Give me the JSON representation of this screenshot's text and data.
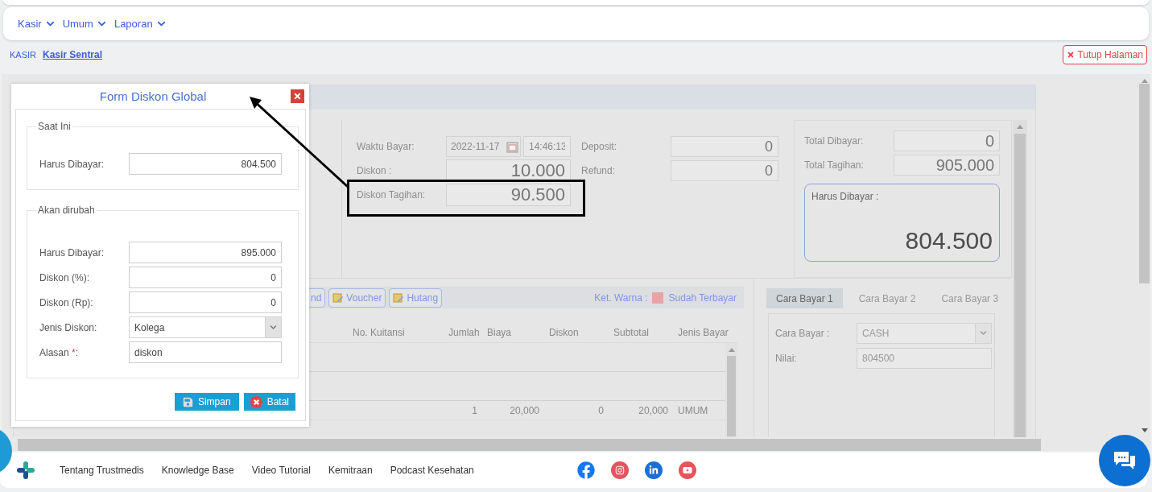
{
  "nav": [
    {
      "label": "Kasir"
    },
    {
      "label": "Umum"
    },
    {
      "label": "Laporan"
    }
  ],
  "breadcrumb": {
    "section": "KASIR",
    "page": "Kasir Sentral"
  },
  "close_page_button": {
    "label": "Tutup Halaman"
  },
  "payment_info": {
    "waktu_bayar": {
      "label": "Waktu Bayar:",
      "date": "2022-11-17",
      "time": "14:46:13"
    },
    "diskon": {
      "label": "Diskon :",
      "value": "10.000"
    },
    "diskon_tagihan": {
      "label": "Diskon Tagihan:",
      "value": "90.500"
    },
    "deposit": {
      "label": "Deposit:",
      "value": "0"
    },
    "refund": {
      "label": "Refund:",
      "value": "0"
    }
  },
  "totals": {
    "total_dibayar": {
      "label": "Total Dibayar:",
      "value": "0"
    },
    "total_tagihan": {
      "label": "Total Tagihan:",
      "value": "905.000"
    },
    "harus_dibayar": {
      "label": "Harus Dibayar :",
      "value": "804.500"
    }
  },
  "toolbar": {
    "buttons": [
      {
        "label": "nd",
        "icon": false
      },
      {
        "label": "Voucher",
        "icon": true
      },
      {
        "label": "Hutang",
        "icon": true
      }
    ],
    "legend": {
      "label": "Ket. Warna :",
      "items": [
        {
          "label": "Sudah Terbayar",
          "color": "#e8a3a6"
        }
      ]
    }
  },
  "table": {
    "columns": [
      "No. Kuitansi",
      "Jumlah",
      "Biaya",
      "Diskon",
      "Subtotal",
      "Jenis Bayar"
    ],
    "rows": [
      {
        "kind": "blank"
      },
      {
        "kind": "blank"
      },
      {
        "kind": "item",
        "jumlah": "1",
        "biaya": "20,000",
        "diskon": "0",
        "subtotal": "20,000",
        "jenis_bayar": "UMUM"
      }
    ]
  },
  "payment_tabs": [
    {
      "label": "Cara Bayar 1",
      "selected": true
    },
    {
      "label": "Cara Bayar 2",
      "selected": false
    },
    {
      "label": "Cara Bayar 3",
      "selected": false
    }
  ],
  "payment_method": {
    "cara_bayar": {
      "label": "Cara Bayar :",
      "value": "CASH"
    },
    "nilai": {
      "label": "Nilai:",
      "value": "804500"
    }
  },
  "modal": {
    "title": "Form Diskon Global",
    "sections": [
      {
        "legend": "Saat Ini",
        "fields": [
          {
            "kind": "number",
            "label": "Harus Dibayar:",
            "value": "804.500"
          }
        ]
      },
      {
        "legend": "Akan dirubah",
        "fields": [
          {
            "kind": "number",
            "label": "Harus Dibayar:",
            "value": "895.000"
          },
          {
            "kind": "number",
            "label": "Diskon (%):",
            "value": "0"
          },
          {
            "kind": "number",
            "label": "Diskon (Rp):",
            "value": "0"
          },
          {
            "kind": "select",
            "label": "Jenis Diskon:",
            "value": "Kolega"
          },
          {
            "kind": "text",
            "label": "Alasan ",
            "required_mark": "*",
            "label_end": ":",
            "value": "diskon"
          }
        ]
      }
    ],
    "buttons": [
      {
        "kind": "save",
        "label": "Simpan"
      },
      {
        "kind": "cancel",
        "label": "Batal"
      }
    ]
  },
  "footer": {
    "links": [
      "Tentang Trustmedis",
      "Knowledge Base",
      "Video Tutorial",
      "Kemitraan",
      "Podcast Kesehatan"
    ]
  }
}
